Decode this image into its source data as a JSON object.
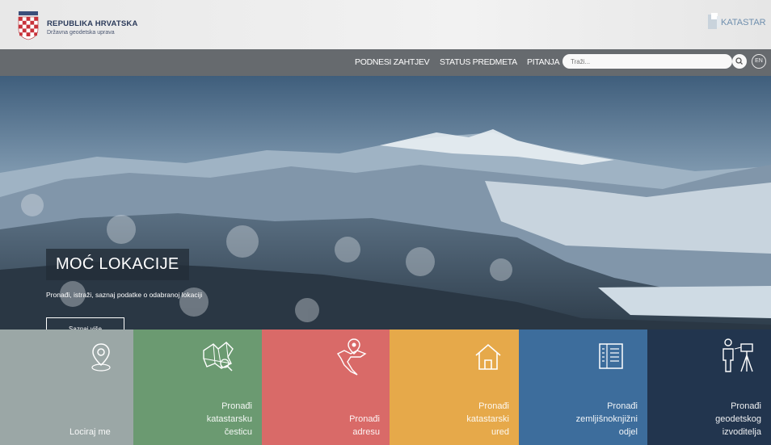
{
  "header": {
    "brand_title": "REPUBLIKA HRVATSKA",
    "brand_subtitle": "Državna geodetska uprava",
    "katastar_label": "KATASTAR"
  },
  "nav": {
    "items": [
      "PODNESI ZAHTJEV",
      "STATUS PREDMETA",
      "PITANJA"
    ],
    "search_placeholder": "Traži...",
    "lang_label": "EN"
  },
  "hero": {
    "title": "MOĆ LOKACIJE",
    "subtitle": "Pronađi, istraži, saznaj podatke o odabranoj lokaciji",
    "button_label": "Saznaj više"
  },
  "tiles": [
    {
      "label": "Lociraj me",
      "icon": "location-pin-icon",
      "color": "#9ba7a6"
    },
    {
      "label": "Pronađi\nkatastarsku\nčesticu",
      "icon": "parcel-map-icon",
      "color": "#6b9a71"
    },
    {
      "label": "Pronađi\nadresu",
      "icon": "croatia-map-pin-icon",
      "color": "#d96a68"
    },
    {
      "label": "Pronađi\nkatastarski\nured",
      "icon": "house-icon",
      "color": "#e6a94a"
    },
    {
      "label": "Pronađi\nzemljišnoknjižni\nodjel",
      "icon": "land-registry-book-icon",
      "color": "#3d6d9c"
    },
    {
      "label": "Pronađi\ngeodetskog\nizvoditelja",
      "icon": "surveyor-icon",
      "color": "#22354e"
    }
  ]
}
